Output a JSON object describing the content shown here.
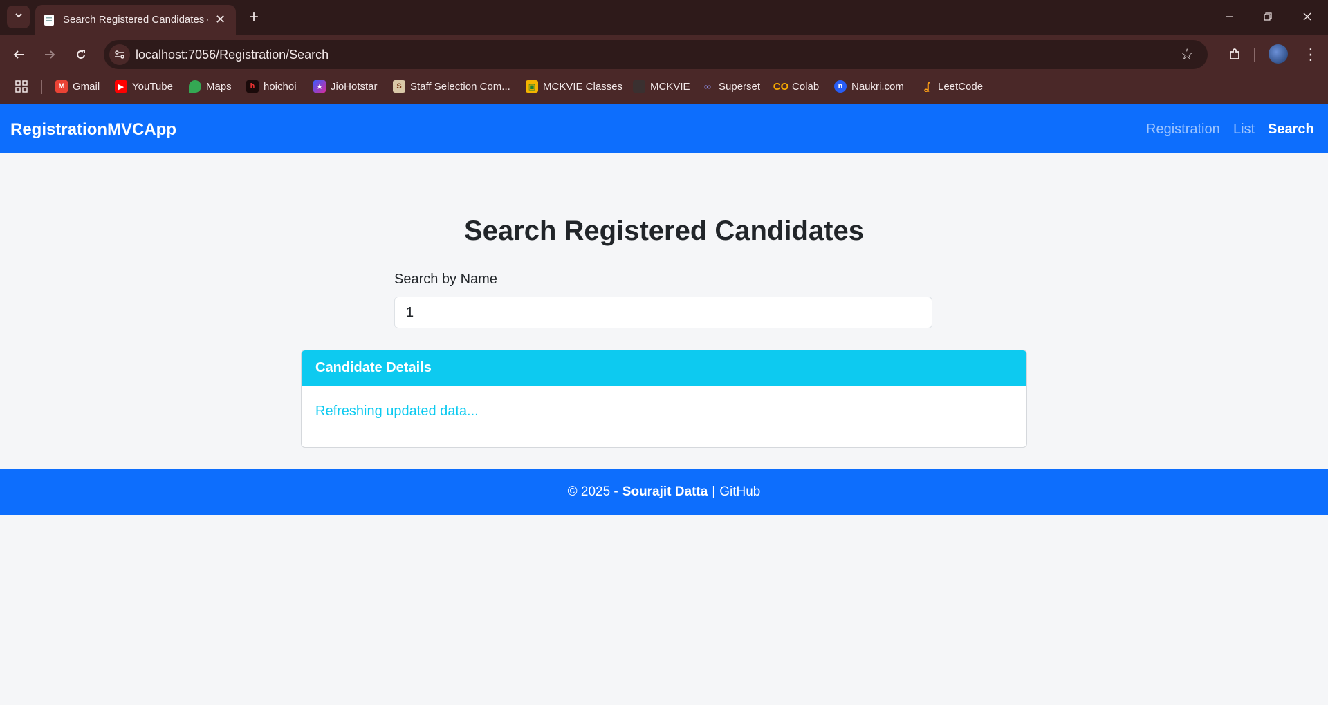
{
  "browser": {
    "tab_title": "Search Registered Candidates - RegistrationMVCApp",
    "url": "localhost:7056/Registration/Search",
    "bookmarks": [
      {
        "label": "Gmail",
        "icon": "gmail-icon",
        "color": "#ea4335"
      },
      {
        "label": "YouTube",
        "icon": "youtube-icon",
        "color": "#ff0000"
      },
      {
        "label": "Maps",
        "icon": "maps-icon",
        "color": "#34a853"
      },
      {
        "label": "hoichoi",
        "icon": "hoichoi-icon",
        "color": "#c4161c"
      },
      {
        "label": "JioHotstar",
        "icon": "jiohotstar-icon",
        "color": "#3b5bfd"
      },
      {
        "label": "Staff Selection Com...",
        "icon": "ssc-icon",
        "color": "#d9c8a8"
      },
      {
        "label": "MCKVIE Classes",
        "icon": "classroom-icon",
        "color": "#f4b400"
      },
      {
        "label": "MCKVIE",
        "icon": "mckvie-icon",
        "color": "#3a3030"
      },
      {
        "label": "Superset",
        "icon": "superset-icon",
        "color": "#6b6bd6"
      },
      {
        "label": "Colab",
        "icon": "colab-icon",
        "color": "#f9ab00"
      },
      {
        "label": "Naukri.com",
        "icon": "naukri-icon",
        "color": "#275df5"
      },
      {
        "label": "LeetCode",
        "icon": "leetcode-icon",
        "color": "#ffa116"
      }
    ]
  },
  "navbar": {
    "brand": "RegistrationMVCApp",
    "links": [
      {
        "label": "Registration",
        "active": false
      },
      {
        "label": "List",
        "active": false
      },
      {
        "label": "Search",
        "active": true
      }
    ]
  },
  "main": {
    "title": "Search Registered Candidates",
    "search_label": "Search by Name",
    "search_value": "1",
    "card_header": "Candidate Details",
    "card_status": "Refreshing updated data..."
  },
  "footer": {
    "prefix": "© 2025 -",
    "author": "Sourajit Datta",
    "separator": "|",
    "link": "GitHub"
  },
  "colors": {
    "primary": "#0d6efd",
    "info": "#0dcaf0",
    "browser_frame": "#4a2828"
  }
}
